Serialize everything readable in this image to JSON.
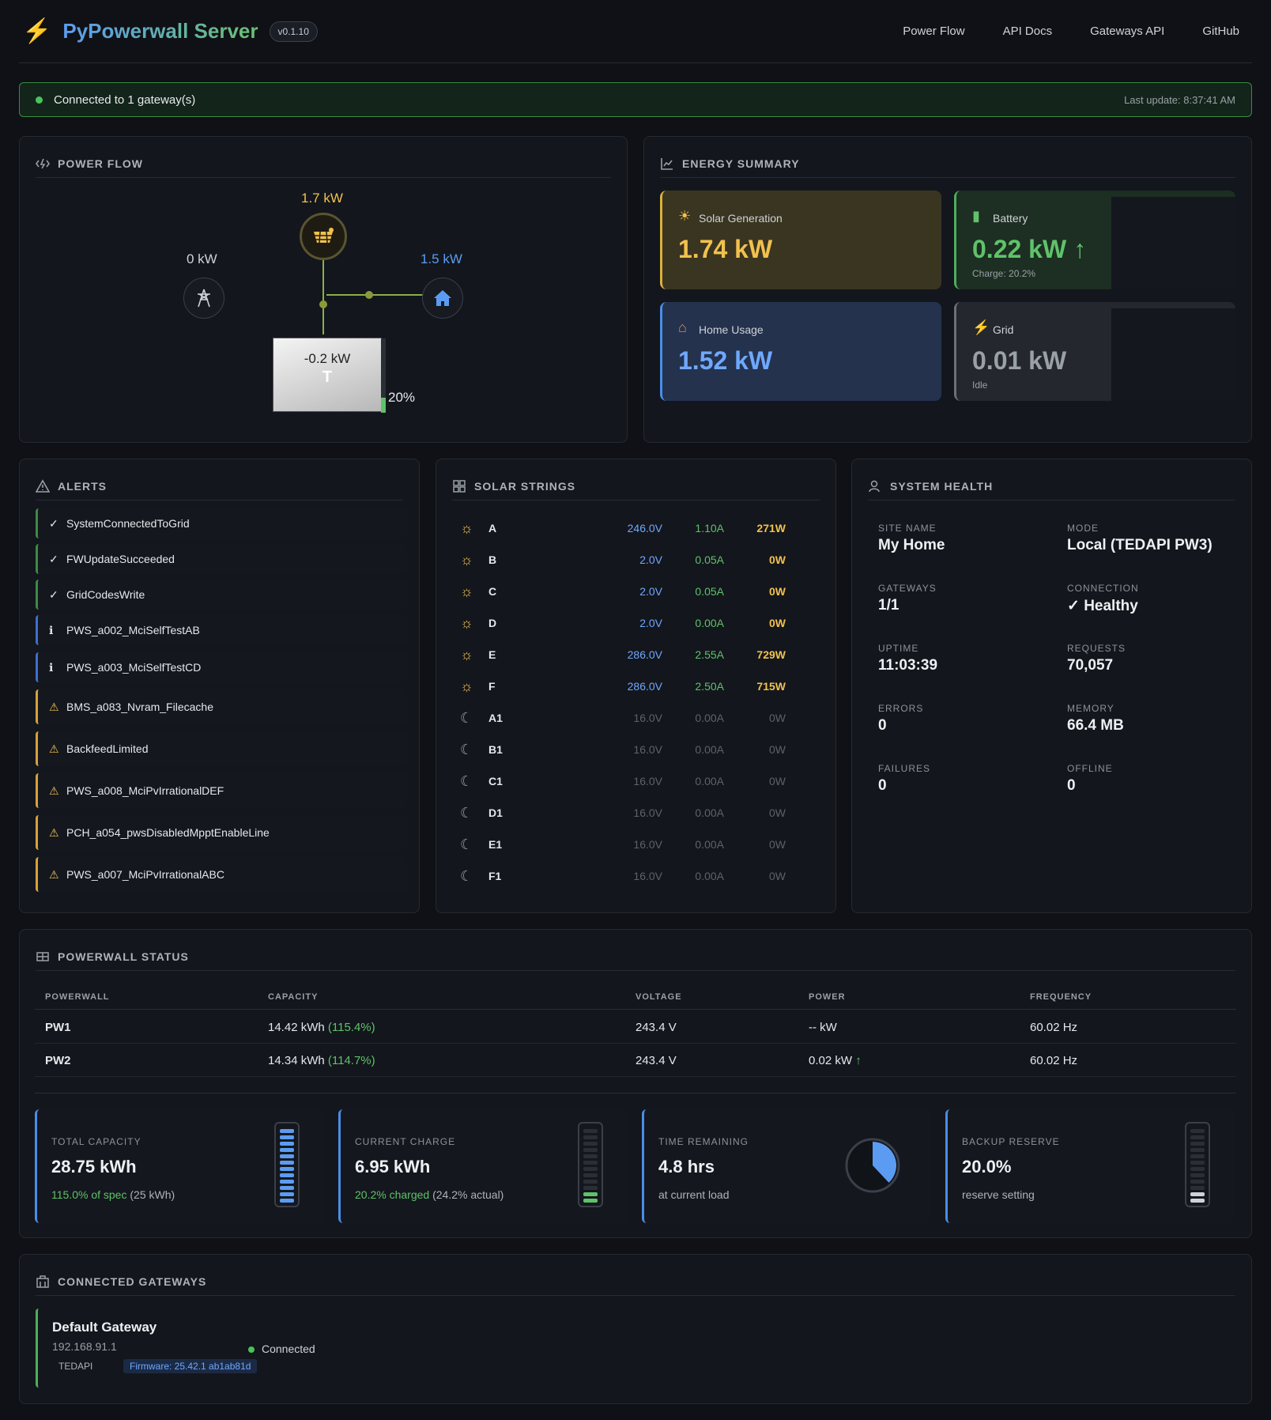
{
  "header": {
    "title": "PyPowerwall Server",
    "version": "v0.1.10",
    "nav": [
      "Power Flow",
      "API Docs",
      "Gateways API",
      "GitHub"
    ]
  },
  "status": {
    "text": "Connected to 1 gateway(s)",
    "last_update": "Last update: 8:37:41 AM"
  },
  "power_flow": {
    "title": "POWER FLOW",
    "solar": "1.7 kW",
    "grid": "0 kW",
    "home": "1.5 kW",
    "battery": "-0.2 kW",
    "battery_pct": "20%",
    "battery_level": 0.2
  },
  "energy": {
    "title": "ENERGY SUMMARY",
    "solar": {
      "label": "Solar Generation",
      "value": "1.74 kW"
    },
    "battery": {
      "label": "Battery",
      "value": "0.22 kW",
      "arrow": "↑",
      "sub": "Charge: 20.2%"
    },
    "home": {
      "label": "Home Usage",
      "value": "1.52 kW"
    },
    "grid": {
      "label": "Grid",
      "value": "0.01 kW",
      "sub": "Idle"
    }
  },
  "alerts": {
    "title": "ALERTS",
    "items": [
      {
        "type": "ok",
        "icon": "✓",
        "text": "SystemConnectedToGrid"
      },
      {
        "type": "ok",
        "icon": "✓",
        "text": "FWUpdateSucceeded"
      },
      {
        "type": "ok",
        "icon": "✓",
        "text": "GridCodesWrite"
      },
      {
        "type": "info",
        "icon": "ℹ",
        "text": "PWS_a002_MciSelfTestAB"
      },
      {
        "type": "info",
        "icon": "ℹ",
        "text": "PWS_a003_MciSelfTestCD"
      },
      {
        "type": "warn",
        "icon": "⚠",
        "text": "BMS_a083_Nvram_Filecache"
      },
      {
        "type": "warn",
        "icon": "⚠",
        "text": "BackfeedLimited"
      },
      {
        "type": "warn",
        "icon": "⚠",
        "text": "PWS_a008_MciPvIrrationalDEF"
      },
      {
        "type": "warn",
        "icon": "⚠",
        "text": "PCH_a054_pwsDisabledMpptEnableLine"
      },
      {
        "type": "warn",
        "icon": "⚠",
        "text": "PWS_a007_MciPvIrrationalABC"
      }
    ]
  },
  "solar_strings": {
    "title": "SOLAR STRINGS",
    "rows": [
      {
        "name": "A",
        "v": "246.0V",
        "a": "1.10A",
        "w": "271W",
        "active": true
      },
      {
        "name": "B",
        "v": "2.0V",
        "a": "0.05A",
        "w": "0W",
        "active": true
      },
      {
        "name": "C",
        "v": "2.0V",
        "a": "0.05A",
        "w": "0W",
        "active": true
      },
      {
        "name": "D",
        "v": "2.0V",
        "a": "0.00A",
        "w": "0W",
        "active": true
      },
      {
        "name": "E",
        "v": "286.0V",
        "a": "2.55A",
        "w": "729W",
        "active": true
      },
      {
        "name": "F",
        "v": "286.0V",
        "a": "2.50A",
        "w": "715W",
        "active": true
      },
      {
        "name": "A1",
        "v": "16.0V",
        "a": "0.00A",
        "w": "0W",
        "active": false
      },
      {
        "name": "B1",
        "v": "16.0V",
        "a": "0.00A",
        "w": "0W",
        "active": false
      },
      {
        "name": "C1",
        "v": "16.0V",
        "a": "0.00A",
        "w": "0W",
        "active": false
      },
      {
        "name": "D1",
        "v": "16.0V",
        "a": "0.00A",
        "w": "0W",
        "active": false
      },
      {
        "name": "E1",
        "v": "16.0V",
        "a": "0.00A",
        "w": "0W",
        "active": false
      },
      {
        "name": "F1",
        "v": "16.0V",
        "a": "0.00A",
        "w": "0W",
        "active": false
      }
    ]
  },
  "health": {
    "title": "SYSTEM HEALTH",
    "site_name_label": "SITE NAME",
    "site_name": "My Home",
    "mode_label": "MODE",
    "mode": "Local (TEDAPI PW3)",
    "gateways_label": "GATEWAYS",
    "gateways": "1/1",
    "connection_label": "CONNECTION",
    "connection": "✓ Healthy",
    "uptime_label": "UPTIME",
    "uptime": "11:03:39",
    "requests_label": "REQUESTS",
    "requests": "70,057",
    "errors_label": "ERRORS",
    "errors": "0",
    "memory_label": "MEMORY",
    "memory": "66.4 MB",
    "failures_label": "FAILURES",
    "failures": "0",
    "offline_label": "OFFLINE",
    "offline": "0"
  },
  "powerwall": {
    "title": "POWERWALL STATUS",
    "headers": [
      "POWERWALL",
      "CAPACITY",
      "VOLTAGE",
      "POWER",
      "FREQUENCY"
    ],
    "rows": [
      {
        "name": "PW1",
        "capacity": "14.42 kWh",
        "capacity_pct": "(115.4%)",
        "voltage": "243.4 V",
        "power": "-- kW",
        "power_arrow": "",
        "frequency": "60.02 Hz"
      },
      {
        "name": "PW2",
        "capacity": "14.34 kWh",
        "capacity_pct": "(114.7%)",
        "voltage": "243.4 V",
        "power": "0.02 kW",
        "power_arrow": "↑",
        "frequency": "60.02 Hz"
      }
    ],
    "stats": {
      "total": {
        "label": "TOTAL CAPACITY",
        "value": "28.75 kWh",
        "sub_green": "115.0% of spec",
        "sub": "(25 kWh)",
        "level": 1.0
      },
      "charge": {
        "label": "CURRENT CHARGE",
        "value": "6.95 kWh",
        "sub_green": "20.2% charged",
        "sub": "(24.2% actual)",
        "level": 0.2
      },
      "time": {
        "label": "TIME REMAINING",
        "value": "4.8 hrs",
        "sub": "at current load",
        "level": 0.38
      },
      "reserve": {
        "label": "BACKUP RESERVE",
        "value": "20.0%",
        "sub": "reserve setting",
        "level": 0.2
      }
    }
  },
  "gateways": {
    "title": "CONNECTED GATEWAYS",
    "name": "Default Gateway",
    "ip": "192.168.91.1",
    "status": "Connected",
    "type": "TEDAPI",
    "firmware": "Firmware: 25.42.1 ab1ab81d"
  },
  "colors": {
    "solar": "#f2c14e",
    "battery": "#5fc26a",
    "home": "#5b9cf2",
    "grid": "#9aa0a8",
    "warn": "#d7a23a",
    "info": "#3d6fd0",
    "ok": "#3d8a45"
  }
}
